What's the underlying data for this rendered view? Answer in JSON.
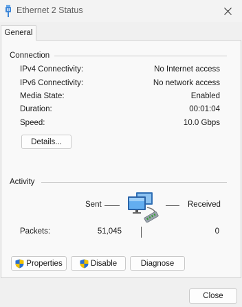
{
  "window": {
    "title": "Ethernet 2 Status"
  },
  "tabs": [
    {
      "label": "General",
      "selected": true
    }
  ],
  "connection": {
    "group_label": "Connection",
    "rows": [
      {
        "label": "IPv4 Connectivity:",
        "value": "No Internet access"
      },
      {
        "label": "IPv6 Connectivity:",
        "value": "No network access"
      },
      {
        "label": "Media State:",
        "value": "Enabled"
      },
      {
        "label": "Duration:",
        "value": "00:01:04"
      },
      {
        "label": "Speed:",
        "value": "10.0 Gbps"
      }
    ],
    "details_button": "Details..."
  },
  "activity": {
    "group_label": "Activity",
    "sent_label": "Sent",
    "received_label": "Received",
    "packets_label": "Packets:",
    "packets_sent": "51,045",
    "packets_received": "0"
  },
  "actions": {
    "properties": "Properties",
    "disable": "Disable",
    "diagnose": "Diagnose"
  },
  "footer": {
    "close": "Close"
  },
  "icons": {
    "title": "network-adapter-icon",
    "close": "close-icon",
    "shield": "uac-shield-icon",
    "network": "network-computers-icon"
  },
  "colors": {
    "window_bg": "#f0f0f0",
    "panel_bg": "#f9f9f9",
    "shield_blue": "#2b6fd0",
    "shield_yellow": "#f2c200"
  }
}
